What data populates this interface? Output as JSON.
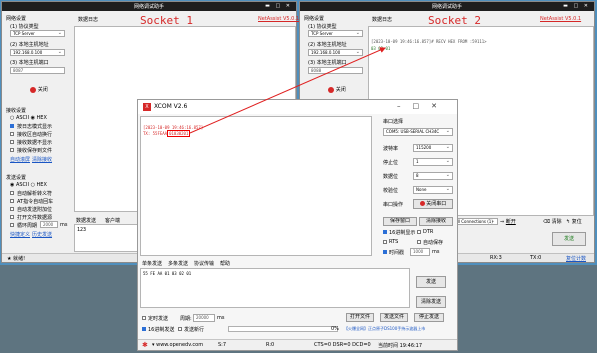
{
  "socket1": {
    "window_title": "网络调试助手",
    "header_label": "Socket 1",
    "brand": "NetAssist V5.0.1",
    "network_settings": "网络设置",
    "protocol_label": "(1) 协议类型",
    "protocol_value": "TCP Server",
    "host_label": "(2) 本地主机地址",
    "host_value": "192.168.0.100",
    "port_label": "(3) 本地主机端口",
    "port_value": "8087",
    "close_button": "关闭",
    "data_log": "数据日志",
    "recv_settings": "接收设置",
    "recv_ascii": "ASCII",
    "recv_hex": "HEX",
    "recv_log_mode": "按日志模式显示",
    "recv_auto_newline": "接收区自动换行",
    "recv_hide": "接收数据不显示",
    "recv_save_file": "接收保存到文件",
    "auto_scroll": "自动滚屏",
    "clear_recv": "清除接收",
    "send_settings": "发送设置",
    "send_ascii": "ASCII",
    "send_hex": "HEX",
    "auto_escape": "自动解析转义符",
    "at_cmd": "AT指令自动回车",
    "auto_append": "自动发送附加位",
    "open_file_send": "打开文件数据源",
    "loop_period": "循环周期",
    "loop_ms": "2000",
    "loop_unit": "ms",
    "shortcut_def": "快捷定义",
    "history_send": "历史发送",
    "data_send_tab": "数据发送",
    "client_tab": "客户端",
    "send_text": "123",
    "status_ready": "就绪!"
  },
  "socket2": {
    "window_title": "网络调试助手",
    "header_label": "Socket 2",
    "brand": "NetAssist V5.0.1",
    "network_settings": "网络设置",
    "protocol_label": "(1) 协议类型",
    "protocol_value": "TCP Server",
    "host_label": "(2) 本地主机地址",
    "host_value": "192.168.0.100",
    "port_label": "(3) 本地主机端口",
    "port_value": "8088",
    "close_button": "关闭",
    "data_log": "数据日志",
    "recv_line1": "[2023-10-09 19:46:16.857]# RECV HEX FROM :59111>",
    "recv_line2": "03 02 01",
    "client_select": "All Connections (1)",
    "disconnect": "断开",
    "clear": "清除",
    "reset": "复位",
    "send": "发送",
    "rx_count": "RX:3",
    "tx_count": "TX:0",
    "reset_count": "复位计数"
  },
  "xcom": {
    "title": "XCOM V2.6",
    "log_line1": "[2023-10-09 19:46:16.857]",
    "log_line2_prefix": "TX: 55FEAA",
    "log_line2_hl": "01030201",
    "serial_select_label": "串口选择",
    "serial_port_value": "COM5: USB-SERIAL CH34C",
    "baud_label": "波特率",
    "baud_value": "115200",
    "stop_label": "停止位",
    "stop_value": "1",
    "data_label": "数据位",
    "data_value": "8",
    "parity_label": "校验位",
    "parity_value": "None",
    "op_label": "串口操作",
    "close_port": "关闭串口",
    "save_window": "保存窗口",
    "clear_recv": "清除接收",
    "hex_display": "16进制显示",
    "dtr": "DTR",
    "rts": "RTS",
    "auto_save": "自动保存",
    "timestamp": "时间戳",
    "ts_ms": "1000",
    "ts_unit": "ms",
    "tabs": [
      "单条发送",
      "多条发送",
      "协议传输",
      "帮助"
    ],
    "send_input": "55 FE AA 01 03 02 01",
    "send_button": "发送",
    "clear_send_button": "清除发送",
    "timed_send": "定时发送",
    "period_label": "周期:",
    "period_value": "20000",
    "period_unit": "ms",
    "open_file": "打开文件",
    "send_file": "发送文件",
    "stop_send": "停止发送",
    "hex_send": "16进制发送",
    "send_newline": "发送新行",
    "progress_pct": "0%",
    "promo": "【火爆全网】正点原子DS100手持示波器上市",
    "url": "www.openedv.com",
    "s_count": "S:7",
    "r_count": "R:0",
    "status_lines": "CTS=0 DSR=0 DCD=0",
    "time": "当前时间 19:46:17"
  }
}
